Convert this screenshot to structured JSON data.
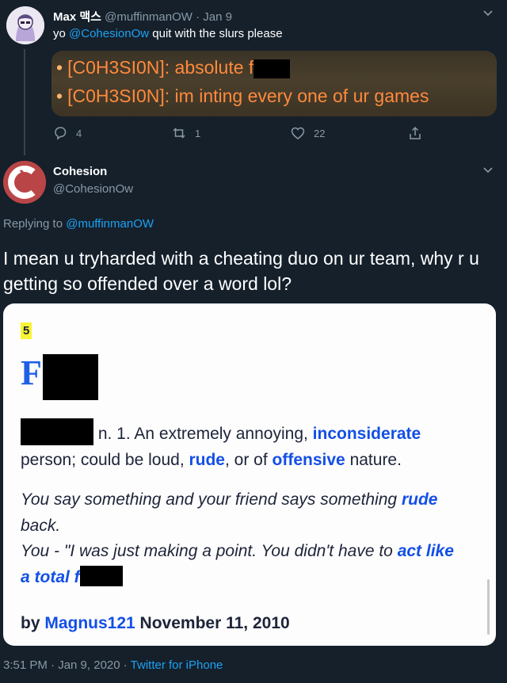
{
  "tweet1": {
    "display_name": "Max 맥스",
    "handle": "@muffinmanOW",
    "date": "· Jan 9",
    "text_prefix": "yo ",
    "mention": "@CohesionOw",
    "text_suffix": " quit with the slurs please",
    "image": {
      "line1_tag": "[C0H3SI0N]:",
      "line1_text": " absolute f",
      "line2_tag": "[C0H3SI0N]:",
      "line2_text": " im inting every one of ur games"
    },
    "actions": {
      "replies": "4",
      "retweets": "1",
      "likes": "22"
    }
  },
  "tweet2": {
    "display_name": "Cohesion",
    "handle": "@CohesionOw",
    "replying_label": "Replying to ",
    "replying_handle": "@muffinmanOW",
    "text": "I mean u tryharded with a cheating duo on ur team, why r u getting so offended over a word lol?",
    "card": {
      "rank": "5",
      "word_initial": "F",
      "def_part1": " n. 1. An extremely annoying, ",
      "def_link1": "inconsiderate",
      "def_part2": " person; could be loud, ",
      "def_link2": "rude",
      "def_part3": ", or of ",
      "def_link3": "offensive",
      "def_part4": " nature.",
      "ex_part1": "You say something and your friend says something ",
      "ex_link1": "rude",
      "ex_part2": " back.",
      "ex_part3": "You - \"I was just making a point. You didn't have to ",
      "ex_link2": "act like",
      "ex_link3": "a total f",
      "by_label": "by ",
      "author": "Magnus121",
      "date": " November 11, 2010"
    },
    "timestamp": "3:51 PM · Jan 9, 2020 · ",
    "source": "Twitter for iPhone"
  },
  "colors": {
    "background": "#15202b",
    "accent": "#1da1f2",
    "muted": "#8899a6",
    "chat_orange": "#ff8a3d",
    "card_link_blue": "#134fe6"
  },
  "icons": [
    "reply-icon",
    "retweet-icon",
    "like-icon",
    "share-icon",
    "chevron-down-icon"
  ]
}
